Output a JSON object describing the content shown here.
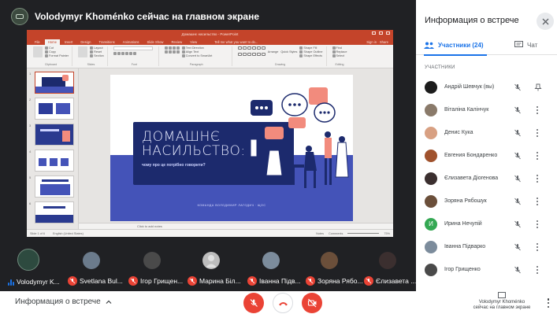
{
  "presenter_banner": "Volodymyr Khoménko сейчас на главном экране",
  "ppt": {
    "window_title": "Домашнє насильство - PowerPoint",
    "tabs": [
      "File",
      "Home",
      "Insert",
      "Design",
      "Transitions",
      "Animations",
      "Slide Show",
      "Review",
      "View"
    ],
    "tell_me": "Tell me what you want to do...",
    "sign_in": "Sign in",
    "share": "Share",
    "ribbon": {
      "clipboard": {
        "cut": "Cut",
        "copy": "Copy",
        "format_painter": "Format Painter",
        "paste": "Paste",
        "group": "Clipboard"
      },
      "slides": {
        "layout": "Layout",
        "reset": "Reset",
        "section": "Section",
        "new_slide": "New Slide",
        "group": "Slides"
      },
      "font_group": "Font",
      "paragraph_group": "Paragraph",
      "paragraph": {
        "text_direction": "Text Direction",
        "align_text": "Align Text",
        "smartart": "Convert to SmartArt"
      },
      "drawing": {
        "arrange": "Arrange",
        "quick_styles": "Quick Styles",
        "group": "Drawing"
      },
      "shape": {
        "fill": "Shape Fill",
        "outline": "Shape Outline",
        "effects": "Shape Effects"
      },
      "editing": {
        "find": "Find",
        "replace": "Replace",
        "select": "Select",
        "group": "Editing"
      }
    },
    "slide_numbers": [
      "1",
      "2",
      "3",
      "4",
      "5",
      "6"
    ],
    "slide": {
      "title_line1": "ДОМАШНЄ",
      "title_line2": "НАСИЛЬСТВО:",
      "subtitle": "чому про це потрібно говорити?",
      "footer": "КОМАНДА ВОЛОДИМИР ЛАГОДИЧ · ЩОС"
    },
    "notes_placeholder": "Click to add notes",
    "status": {
      "slide_of": "Slide 1 of 6",
      "language": "English (United States)",
      "notes": "Notes",
      "comments": "Comments",
      "zoom": "75%"
    }
  },
  "tiles": [
    {
      "name": "Volodymyr K...",
      "self": true
    },
    {
      "name": "Svetlana Bul..."
    },
    {
      "name": "Ігор Грищен..."
    },
    {
      "name": "Марина Біл..."
    },
    {
      "name": "Іванна Підв..."
    },
    {
      "name": "Зоряна Рябо..."
    },
    {
      "name": "Єлизавета ..."
    }
  ],
  "panel": {
    "title": "Информация о встрече",
    "tab_people_label": "Участники (24)",
    "tab_chat_label": "Чат",
    "section_header": "УЧАСТНИКИ",
    "participants": [
      {
        "name": "Андрій Шевчук (вы)",
        "avatar_color": "#1c1c1c",
        "initial": "",
        "pinned": true
      },
      {
        "name": "Віталіна Калінчук",
        "avatar_color": "#8a7a6a",
        "initial": ""
      },
      {
        "name": "Денис Кука",
        "avatar_color": "#d8a082",
        "initial": ""
      },
      {
        "name": "Евгения Бондаренко",
        "avatar_color": "#a0522d",
        "initial": ""
      },
      {
        "name": "Єлизавета Діогенова",
        "avatar_color": "#3b2f2f",
        "initial": ""
      },
      {
        "name": "Зоряна Рябошук",
        "avatar_color": "#6b4f3a",
        "initial": ""
      },
      {
        "name": "Ирина Нечупій",
        "avatar_color": "#34a853",
        "initial": "И"
      },
      {
        "name": "Іванна Підварко",
        "avatar_color": "#7c8c9c",
        "initial": ""
      },
      {
        "name": "Ігор Грищенко",
        "avatar_color": "#4a4a4a",
        "initial": ""
      }
    ]
  },
  "bottom": {
    "meeting_info": "Информация о встрече",
    "present_line1": "Volodymyr Khoménko",
    "present_line2": "сейчас на главном экране"
  },
  "colors": {
    "accent": "#1a73e8",
    "danger": "#ea4335",
    "ppt_red": "#c4442a",
    "slide_blue": "#4453b8",
    "slide_navy": "#1c2a6d",
    "salmon": "#f28b7d"
  }
}
